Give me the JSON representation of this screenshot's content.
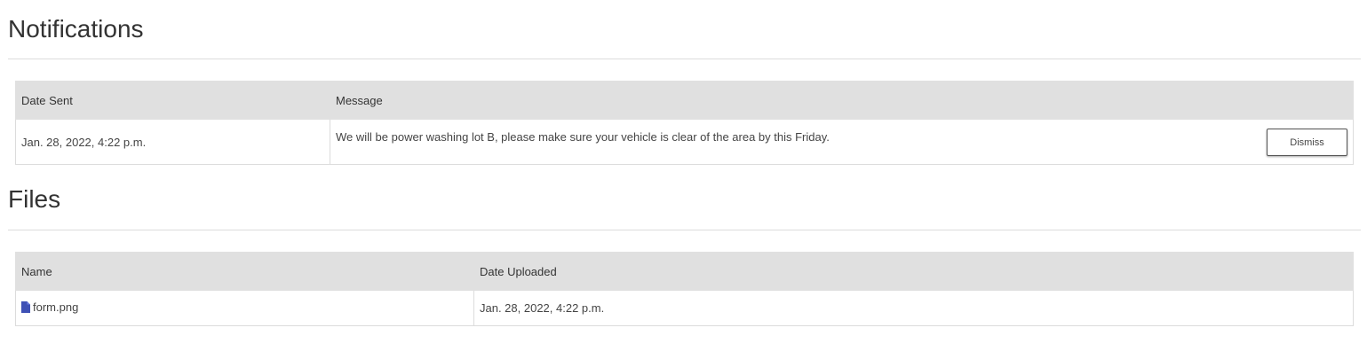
{
  "notifications": {
    "title": "Notifications",
    "columns": [
      "Date Sent",
      "Message"
    ],
    "rows": [
      {
        "date_sent": "Jan. 28, 2022, 4:22 p.m.",
        "message": "We will be power washing lot B, please make sure your vehicle is clear of the area by this Friday.",
        "dismiss_label": "Dismiss"
      }
    ]
  },
  "files": {
    "title": "Files",
    "columns": [
      "Name",
      "Date Uploaded"
    ],
    "rows": [
      {
        "icon": "file-icon",
        "name": "form.png",
        "date_uploaded": "Jan. 28, 2022, 4:22 p.m."
      }
    ]
  },
  "colors": {
    "header_bg": "#e0e0e0",
    "file_icon": "#3f51b5"
  }
}
